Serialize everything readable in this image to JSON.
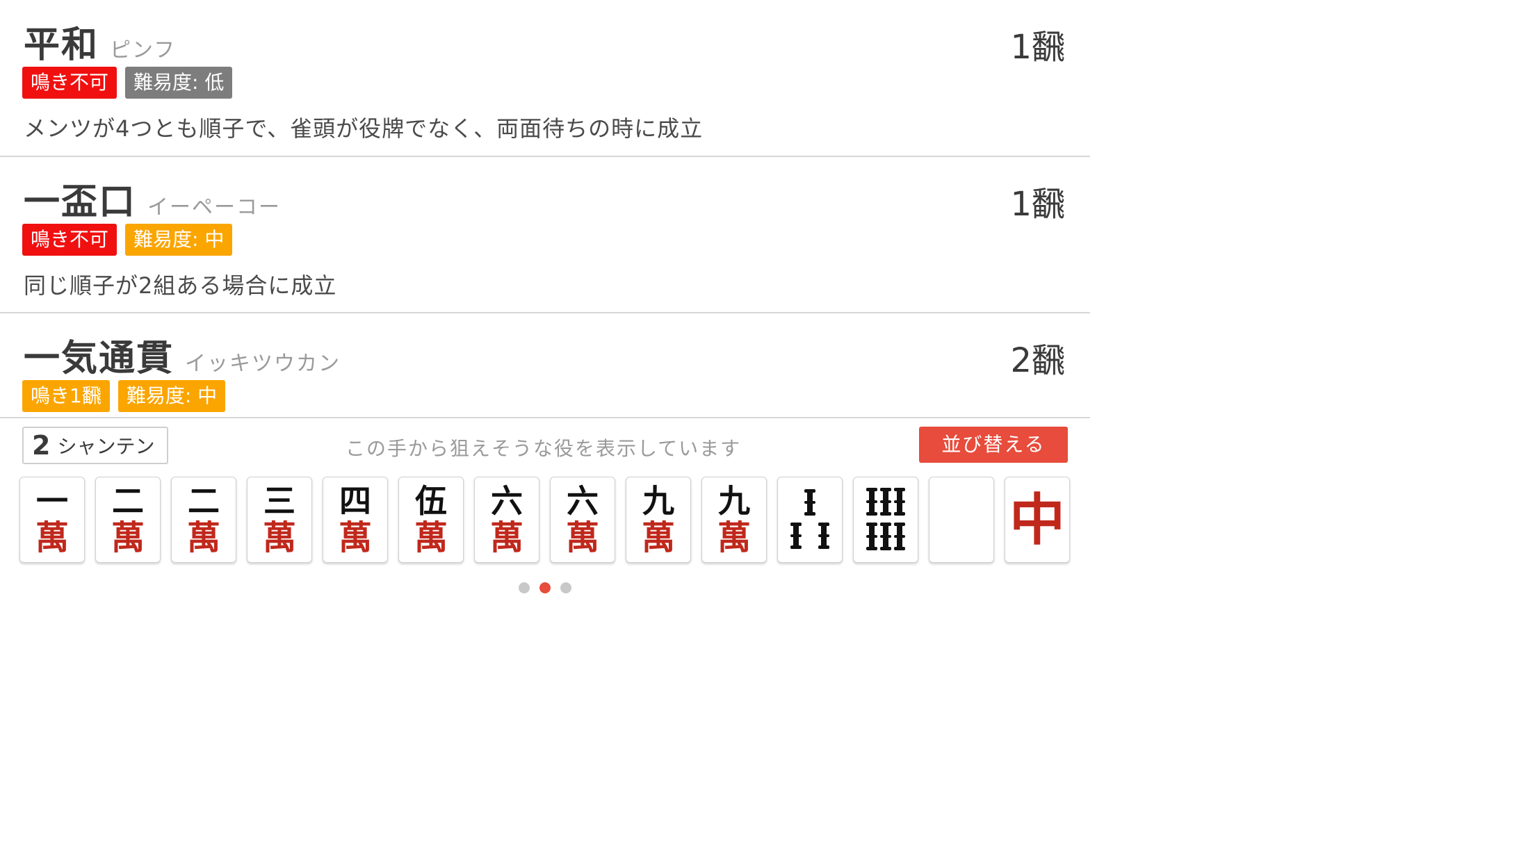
{
  "yaku_list": [
    {
      "name": "平和",
      "reading": "ピンフ",
      "han": "1飜",
      "badges": [
        {
          "label": "鳴き不可",
          "color": "#f01010"
        },
        {
          "label": "難易度: 低",
          "color": "#7d7d7d"
        }
      ],
      "description": "メンツが4つとも順子で、雀頭が役牌でなく、両面待ちの時に成立"
    },
    {
      "name": "一盃口",
      "reading": "イーペーコー",
      "han": "1飜",
      "badges": [
        {
          "label": "鳴き不可",
          "color": "#f01010"
        },
        {
          "label": "難易度: 中",
          "color": "#fba500"
        }
      ],
      "description": "同じ順子が2組ある場合に成立"
    },
    {
      "name": "一気通貫",
      "reading": "イッキツウカン",
      "han": "2飜",
      "badges": [
        {
          "label": "鳴き1飜",
          "color": "#fba500"
        },
        {
          "label": "難易度: 中",
          "color": "#fba500"
        }
      ],
      "description": ""
    }
  ],
  "shanten": {
    "number": "2",
    "label": "シャンテン"
  },
  "hint_text": "この手から狙えそうな役を表示しています",
  "sort_button": "並び替える",
  "hand": [
    {
      "type": "man",
      "num": "一",
      "suit": "萬"
    },
    {
      "type": "man",
      "num": "二",
      "suit": "萬"
    },
    {
      "type": "man",
      "num": "二",
      "suit": "萬"
    },
    {
      "type": "man",
      "num": "三",
      "suit": "萬"
    },
    {
      "type": "man",
      "num": "四",
      "suit": "萬"
    },
    {
      "type": "man",
      "num": "伍",
      "suit": "萬"
    },
    {
      "type": "man",
      "num": "六",
      "suit": "萬"
    },
    {
      "type": "man",
      "num": "六",
      "suit": "萬"
    },
    {
      "type": "man",
      "num": "九",
      "suit": "萬"
    },
    {
      "type": "man",
      "num": "九",
      "suit": "萬"
    },
    {
      "type": "sou3",
      "name": "3-sou"
    },
    {
      "type": "sou6",
      "name": "6-sou"
    },
    {
      "type": "blank",
      "name": "white-dragon"
    },
    {
      "type": "chun",
      "name": "red-dragon",
      "glyph": "中"
    }
  ],
  "page_dots": {
    "count": 3,
    "active": 2
  },
  "colors": {
    "red_badge": "#f01010",
    "gray_badge": "#7d7d7d",
    "orange_badge": "#fba500",
    "accent": "#e74c3c",
    "man_suit": "#c0281c"
  }
}
